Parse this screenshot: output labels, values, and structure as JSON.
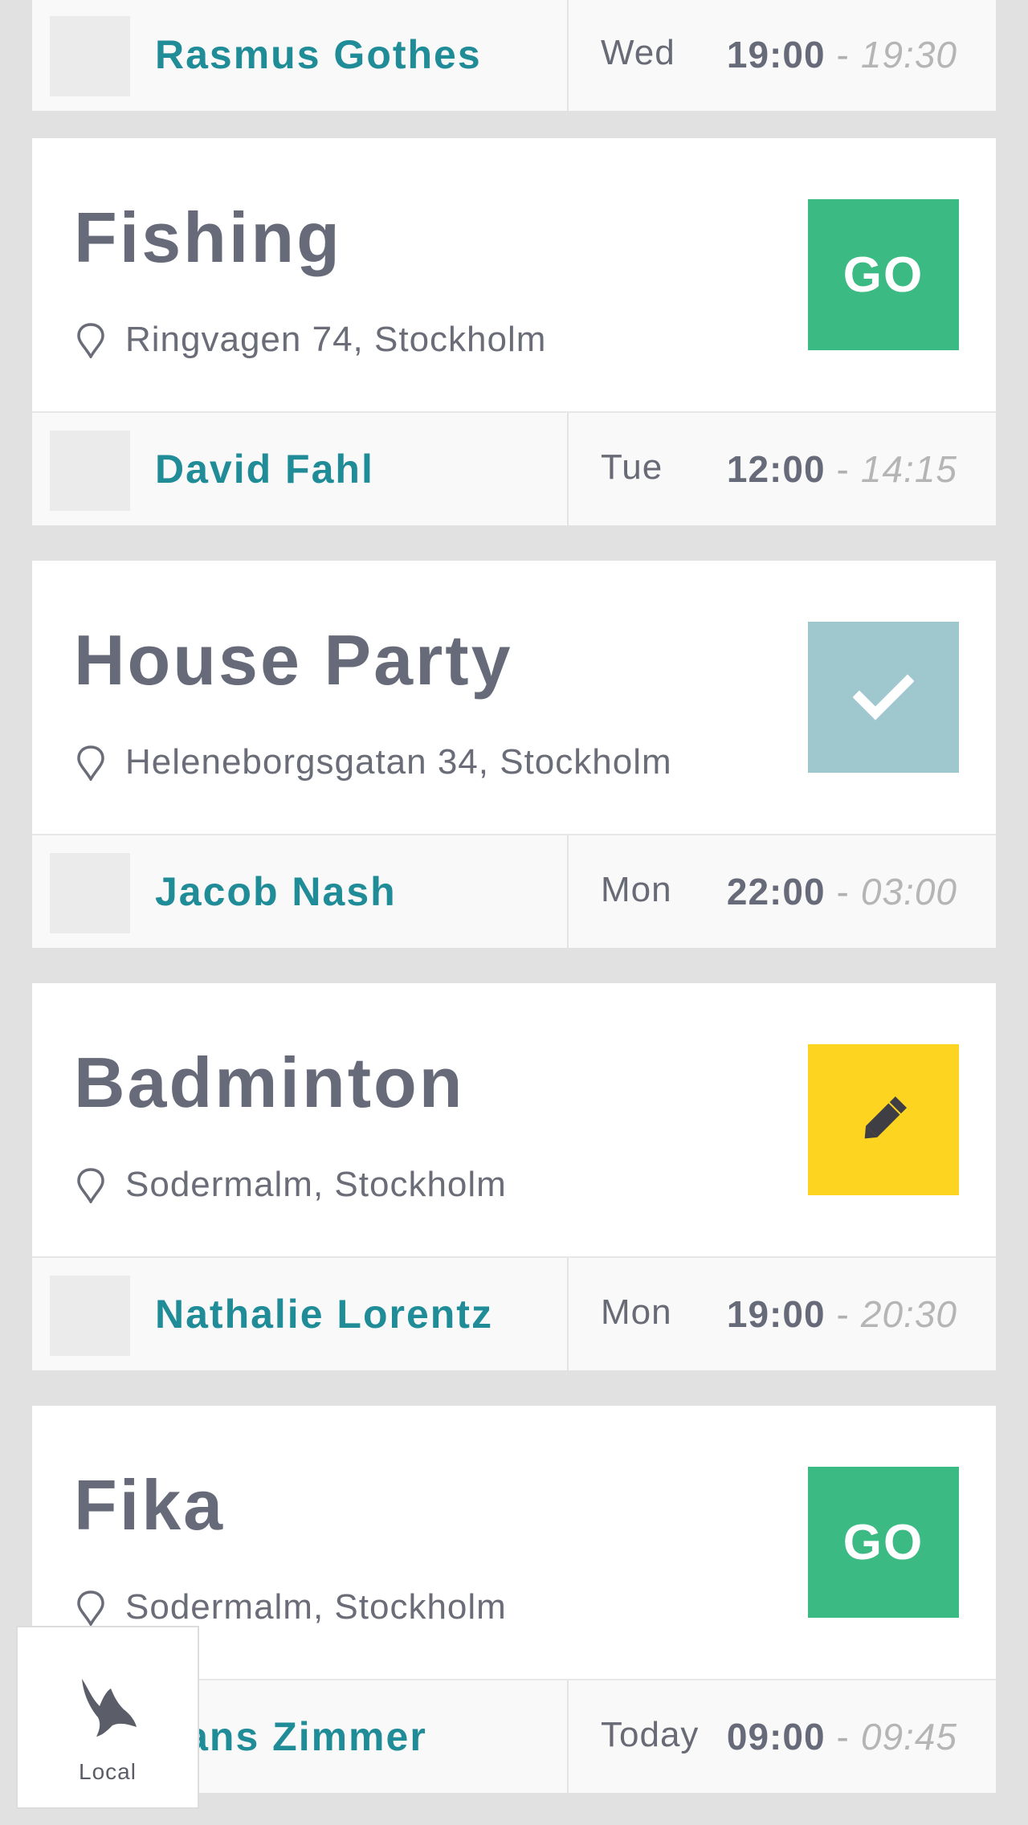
{
  "events": [
    {
      "title": "",
      "location": "",
      "action": "",
      "action_label": "",
      "host": "Rasmus Gothes",
      "day": "Wed",
      "start": "19:00",
      "end": "19:30"
    },
    {
      "title": "Fishing",
      "location": "Ringvagen 74, Stockholm",
      "action": "go",
      "action_label": "GO",
      "host": "David Fahl",
      "day": "Tue",
      "start": "12:00",
      "end": "14:15"
    },
    {
      "title": "House Party",
      "location": "Heleneborgsgatan 34, Stockholm",
      "action": "done",
      "action_label": "",
      "host": "Jacob Nash",
      "day": "Mon",
      "start": "22:00",
      "end": "03:00"
    },
    {
      "title": "Badminton",
      "location": "Sodermalm, Stockholm",
      "action": "edit",
      "action_label": "",
      "host": "Nathalie Lorentz",
      "day": "Mon",
      "start": "19:00",
      "end": "20:30"
    },
    {
      "title": "Fika",
      "location": "Sodermalm, Stockholm",
      "action": "go",
      "action_label": "GO",
      "host": "Hans Zimmer",
      "day": "Today",
      "start": "09:00",
      "end": "09:45"
    }
  ],
  "time_separator": "-",
  "icons": {
    "location": "location-pin-icon",
    "done": "checkmark-icon",
    "edit": "pencil-icon",
    "local": "bird-icon"
  },
  "colors": {
    "go": "#3bba83",
    "done": "#9fc7ce",
    "edit": "#fdd520",
    "host_name": "#1f8c97",
    "title": "#676a79"
  },
  "nav": {
    "local_label": "Local"
  }
}
